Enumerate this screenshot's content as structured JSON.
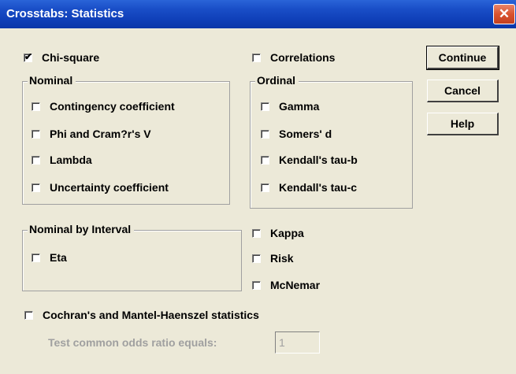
{
  "window": {
    "title": "Crosstabs: Statistics",
    "close_glyph": "✕"
  },
  "checkbox_mark": "✔",
  "chi_square": {
    "label": "Chi-square",
    "checked": true
  },
  "correlations": {
    "label": "Correlations",
    "checked": false
  },
  "nominal": {
    "title": "Nominal",
    "items": [
      {
        "label": "Contingency coefficient"
      },
      {
        "label": "Phi and Cram?r's V"
      },
      {
        "label": "Lambda"
      },
      {
        "label": "Uncertainty coefficient"
      }
    ]
  },
  "ordinal": {
    "title": "Ordinal",
    "items": [
      {
        "label": "Gamma"
      },
      {
        "label": "Somers' d"
      },
      {
        "label": "Kendall's tau-b"
      },
      {
        "label": "Kendall's tau-c"
      }
    ]
  },
  "nominal_by_interval": {
    "title": "Nominal by Interval",
    "items": [
      {
        "label": "Eta"
      }
    ]
  },
  "other": [
    {
      "label": "Kappa"
    },
    {
      "label": "Risk"
    },
    {
      "label": "McNemar"
    }
  ],
  "cmh": {
    "label": "Cochran's and Mantel-Haenszel statistics"
  },
  "odds": {
    "label": "Test common odds ratio equals:",
    "value": "1"
  },
  "buttons": {
    "continue": "Continue",
    "cancel": "Cancel",
    "help": "Help"
  }
}
